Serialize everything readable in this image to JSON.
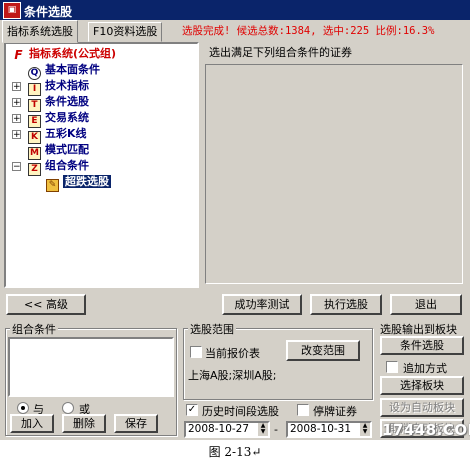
{
  "window": {
    "title": "条件选股"
  },
  "tabs": [
    {
      "label": "指标系统选股"
    },
    {
      "label": "F10资料选股"
    }
  ],
  "status": {
    "text": "选股完成! 候选总数:1384, 选中:225 比例:16.3%"
  },
  "tree": {
    "root": "指标系统(公式组)",
    "nodes": [
      {
        "label": "基本面条件"
      },
      {
        "label": "技术指标"
      },
      {
        "label": "条件选股"
      },
      {
        "label": "交易系统"
      },
      {
        "label": "五彩K线"
      },
      {
        "label": "模式匹配"
      },
      {
        "label": "组合条件"
      }
    ],
    "child": {
      "label": "超跌选股"
    }
  },
  "right_panel": {
    "label": "选出满足下列组合条件的证券"
  },
  "buttons": {
    "advanced": "<< 高级",
    "success_test": "成功率测试",
    "run": "执行选股",
    "exit": "退出"
  },
  "combo": {
    "title": "组合条件",
    "and_label": "与",
    "or_label": "或",
    "add": "加入",
    "delete": "删除",
    "save": "保存"
  },
  "scope": {
    "title": "选股范围",
    "current_price_label": "当前报价表",
    "change_button": "改变范围",
    "markets": "上海A股;深圳A股;",
    "history_label": "历史时间段选股",
    "suspended_label": "停牌证券",
    "date_from": "2008-10-27",
    "date_sep": "-",
    "date_to": "2008-10-31"
  },
  "output": {
    "title": "选股输出到板块",
    "cond_select": "条件选股",
    "append_label": "追加方式",
    "choose_block": "选择板块",
    "set_auto": "设为自动板块",
    "cancel_auto": "取消自动板块"
  },
  "caption": "图 2-13↵",
  "watermark": "17448.COM"
}
